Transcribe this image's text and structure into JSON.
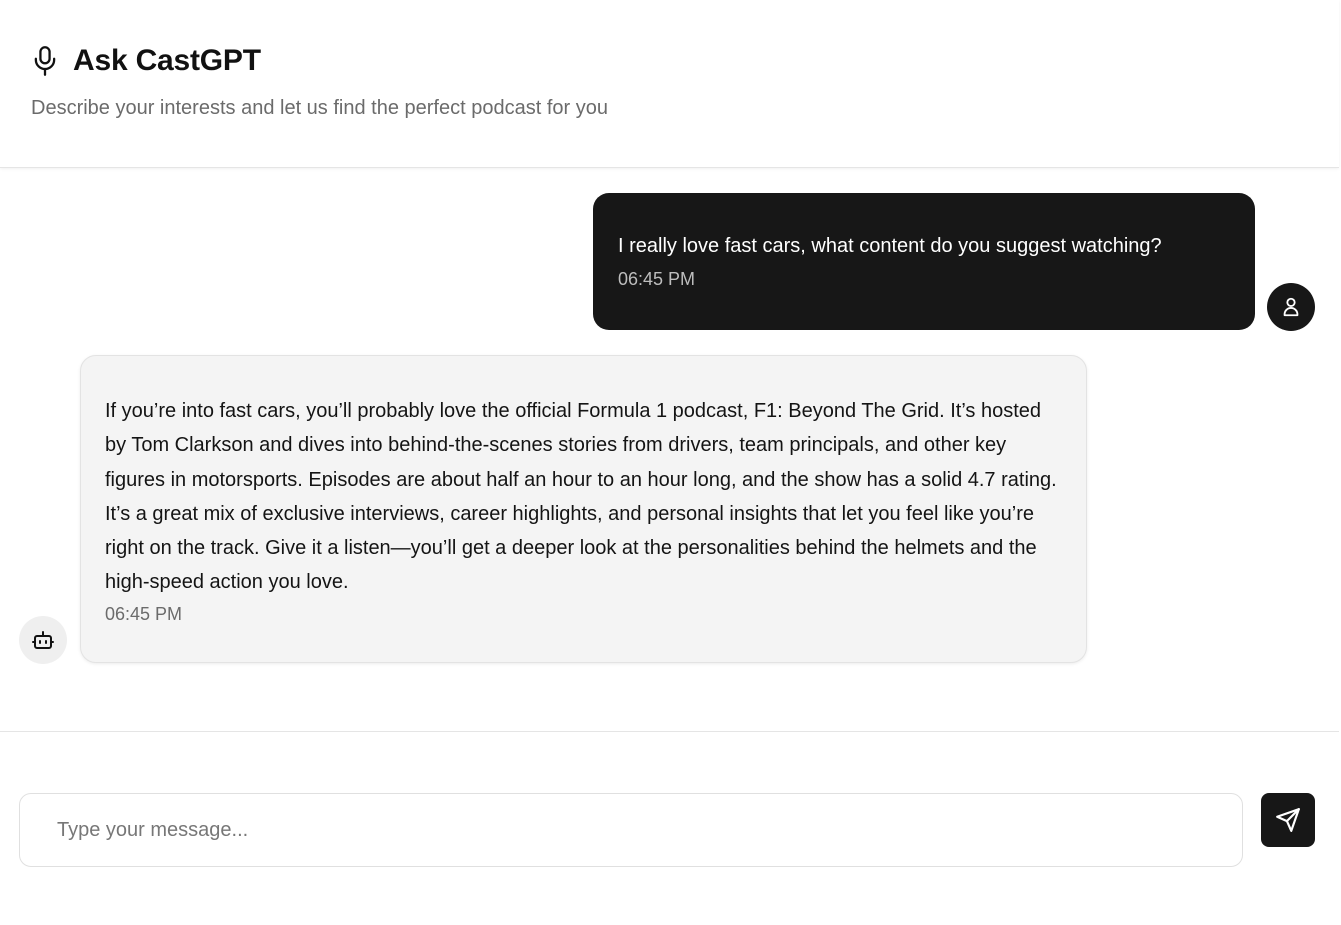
{
  "header": {
    "title": "Ask CastGPT",
    "subtitle": "Describe your interests and let us find the perfect podcast for you",
    "icon": "microphone-icon"
  },
  "messages": [
    {
      "role": "user",
      "text": "I really love fast cars, what content do you suggest watching?",
      "time": "06:45 PM",
      "avatar_icon": "user-icon"
    },
    {
      "role": "assistant",
      "text": "If you’re into fast cars, you’ll probably love the official Formula 1 podcast, F1: Beyond The Grid. It’s hosted by Tom Clarkson and dives into behind-the-scenes stories from drivers, team principals, and other key figures in motorsports. Episodes are about half an hour to an hour long, and the show has a solid 4.7 rating. It’s a great mix of exclusive interviews, career highlights, and personal insights that let you feel like you’re right on the track. Give it a listen—you’ll get a deeper look at the personalities behind the helmets and the high-speed action you love.",
      "time": "06:45 PM",
      "avatar_icon": "bot-icon"
    }
  ],
  "composer": {
    "placeholder": "Type your message...",
    "value": "",
    "send_icon": "send-icon"
  },
  "colors": {
    "user_bubble": "#171717",
    "bot_bubble": "#f4f4f4",
    "accent": "#171717",
    "muted_text": "#6b6b6b"
  }
}
